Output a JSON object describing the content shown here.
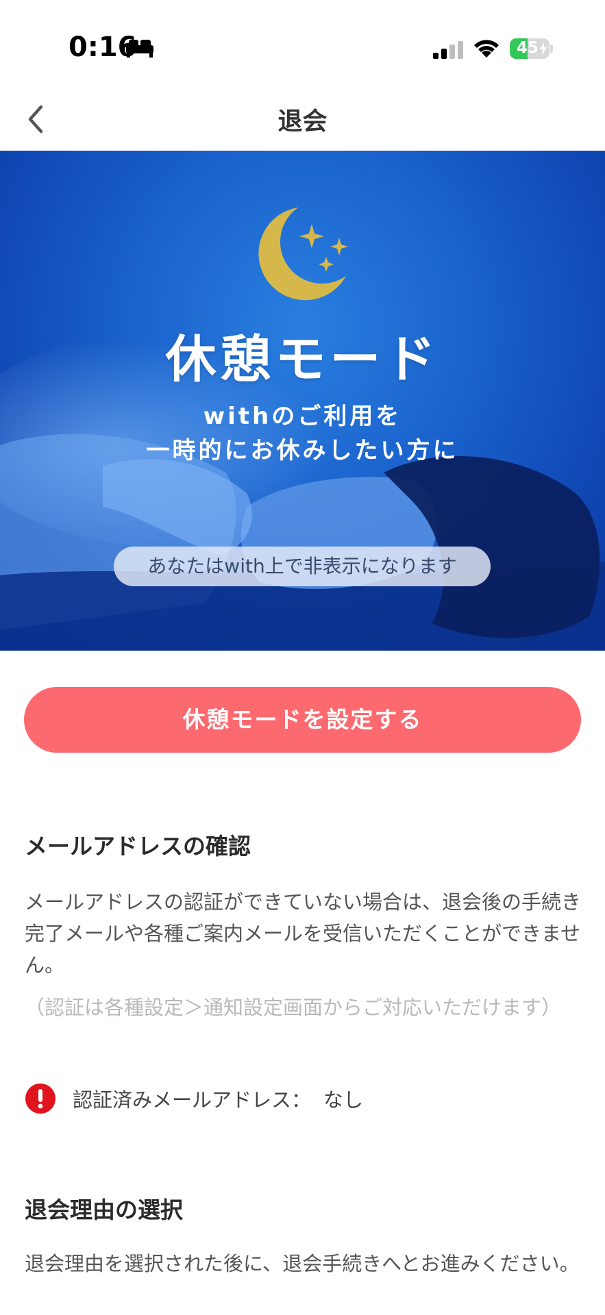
{
  "status_bar": {
    "time": "0:16",
    "battery_level": "45",
    "battery_fraction": 0.45,
    "sleep_icon": "bed-icon",
    "signal_icon": "cellular-signal-icon",
    "wifi_icon": "wifi-icon"
  },
  "nav": {
    "title": "退会",
    "back_icon": "chevron-left-icon"
  },
  "banner": {
    "title": "休憩モード",
    "subtitle_line1": "withのご利用を",
    "subtitle_line2": "一時的にお休みしたい方に",
    "pill_text": "あなたはwith上で非表示になります",
    "moon_icon": "moon-stars-icon"
  },
  "cta": {
    "label": "休憩モードを設定する",
    "color": "#fc6a6f"
  },
  "email_section": {
    "title": "メールアドレスの確認",
    "description": "メールアドレスの認証ができていない場合は、退会後の手続き完了メールや各種ご案内メールを受信いただくことができません。",
    "note": "（認証は各種設定＞通知設定画面からご対応いただけます）",
    "verified_label": "認証済みメールアドレス：",
    "verified_value": "なし",
    "alert_icon": "alert-icon",
    "alert_color": "#e0141e"
  },
  "reason_section": {
    "title": "退会理由の選択",
    "description": "退会理由を選択された後に、退会手続きへとお進みください。"
  }
}
